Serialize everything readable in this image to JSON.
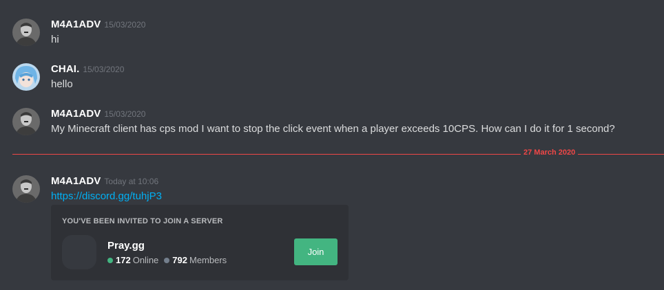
{
  "messages": [
    {
      "author": "M4A1ADV",
      "timestamp": "15/03/2020",
      "text": "hi",
      "avatar": "grayscale-portrait-avatar"
    },
    {
      "author": "CHAI.",
      "timestamp": "15/03/2020",
      "text": "hello",
      "avatar": "anime-blue-hair-avatar"
    },
    {
      "author": "M4A1ADV",
      "timestamp": "15/03/2020",
      "text": "My Minecraft client has cps mod I want to stop the click event when a player exceeds 10CPS. How can I do it for 1 second?",
      "avatar": "grayscale-portrait-avatar"
    },
    {
      "author": "M4A1ADV",
      "timestamp": "Today at 10:06",
      "link": "https://discord.gg/tuhjP3",
      "avatar": "grayscale-portrait-avatar"
    }
  ],
  "divider": {
    "label": "27 March 2020",
    "color": "#f04747"
  },
  "invite": {
    "header": "You've been invited to join a server",
    "server_name": "Pray.gg",
    "online_count": "172",
    "online_label": "Online",
    "member_count": "792",
    "member_label": "Members",
    "join_label": "Join"
  },
  "colors": {
    "background": "#36393f",
    "embed_background": "#2f3136",
    "link": "#00b0f4",
    "join_button": "#43b581",
    "online_dot": "#43b581",
    "members_dot": "#747f8d"
  }
}
